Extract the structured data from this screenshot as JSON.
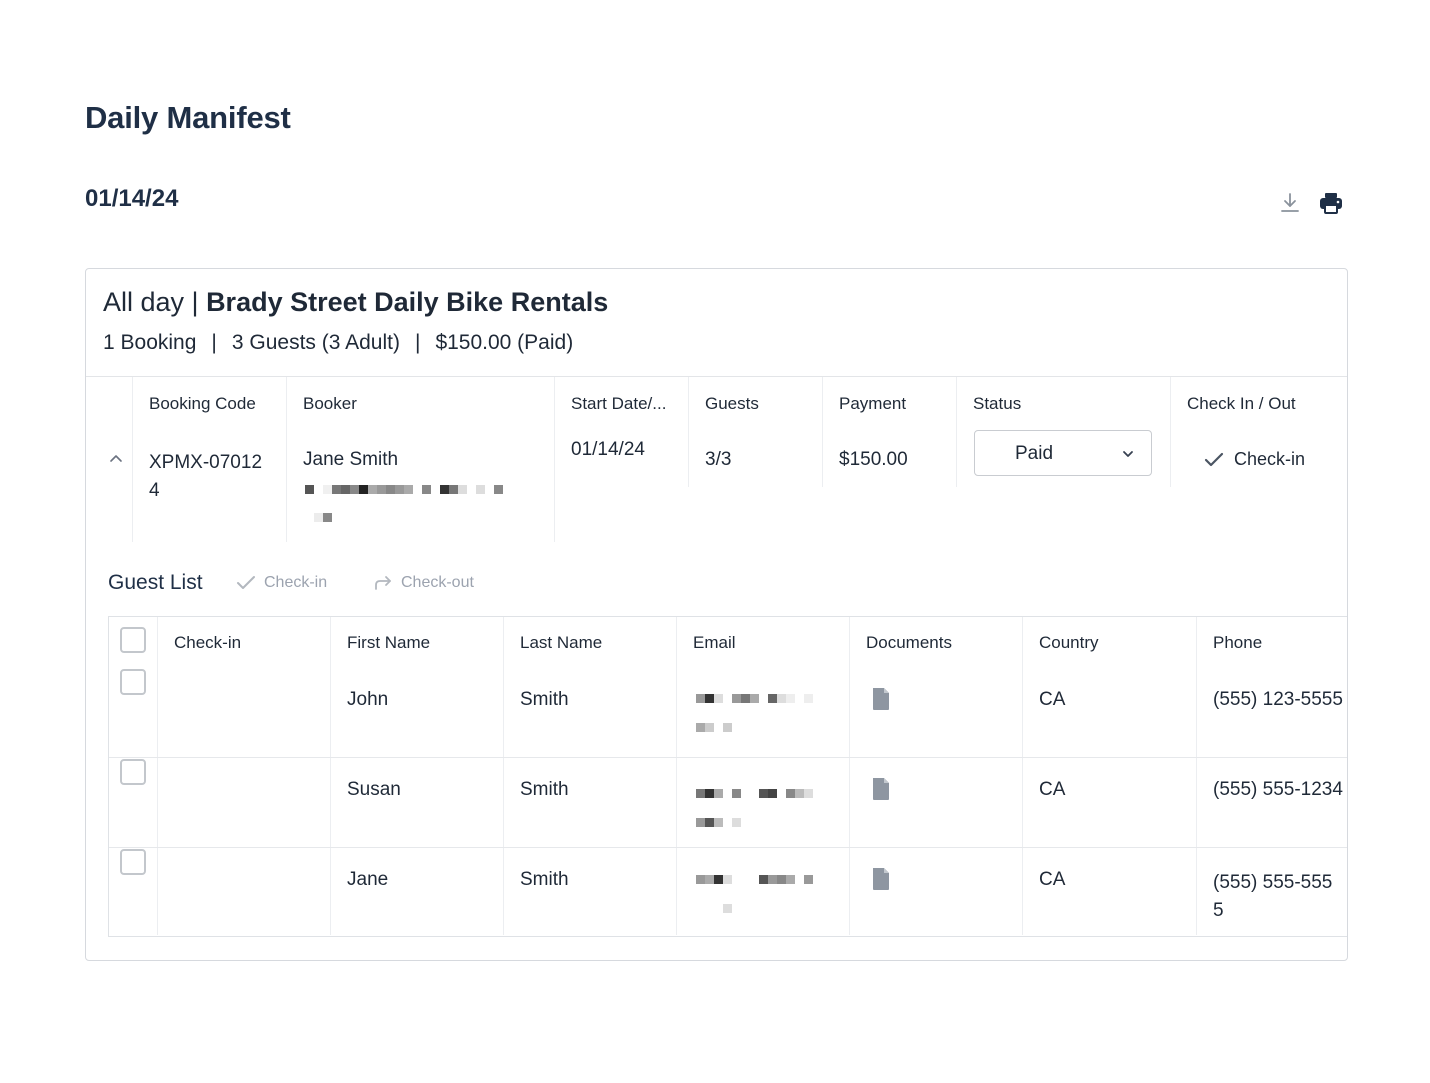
{
  "page": {
    "title": "Daily Manifest",
    "date": "01/14/24"
  },
  "toolbar": {
    "download_icon": "download-icon",
    "print_icon": "print-icon"
  },
  "event": {
    "time_label": "All day | ",
    "name": "Brady Street Daily Bike Rentals",
    "bookings": "1 Booking",
    "guests": "3 Guests (3 Adult)",
    "total": "$150.00 (Paid)",
    "separator": "|"
  },
  "booking_table": {
    "headers": {
      "booking_code": "Booking Code",
      "booker": "Booker",
      "start_date": "Start Date/...",
      "guests": "Guests",
      "payment": "Payment",
      "status": "Status",
      "check_in_out": "Check In / Out"
    },
    "row": {
      "code_line1": "XPMX-07012",
      "code_line2": "4",
      "booker_name": "Jane Smith",
      "start_date": "01/14/24",
      "guests": "3/3",
      "payment": "$150.00",
      "status": "Paid",
      "check_in_label": "Check-in"
    }
  },
  "guest_list": {
    "title": "Guest List",
    "actions": {
      "check_in": "Check-in",
      "check_out": "Check-out"
    },
    "headers": {
      "check_in": "Check-in",
      "first_name": "First Name",
      "last_name": "Last Name",
      "email": "Email",
      "documents": "Documents",
      "country": "Country",
      "phone": "Phone"
    },
    "rows": [
      {
        "first_name": "John",
        "last_name": "Smith",
        "country": "CA",
        "phone": "(555) 123-5555"
      },
      {
        "first_name": "Susan",
        "last_name": "Smith",
        "country": "CA",
        "phone": "(555) 555-1234"
      },
      {
        "first_name": "Jane",
        "last_name": "Smith",
        "country": "CA",
        "phone_line1": "(555) 555-555",
        "phone_line2": "5"
      }
    ]
  },
  "colors": {
    "heading": "#1f2f46",
    "text": "#1f2937",
    "muted": "#9ca3af",
    "border": "#d6d9de",
    "icon": "#9aa1ab"
  }
}
